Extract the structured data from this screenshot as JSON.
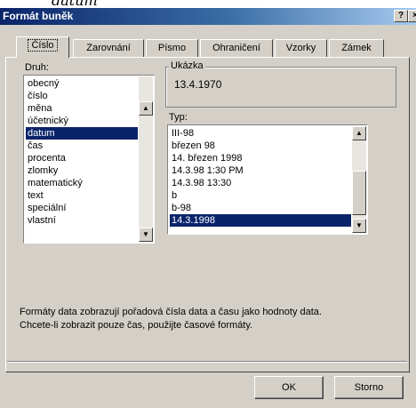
{
  "window": {
    "title": "Formát buněk",
    "help_label": "?",
    "close_label": "×",
    "caption_fragment": "datum"
  },
  "tabs": [
    {
      "label": "Číslo",
      "active": true
    },
    {
      "label": "Zarovnání"
    },
    {
      "label": "Písmo"
    },
    {
      "label": "Ohraničení"
    },
    {
      "label": "Vzorky"
    },
    {
      "label": "Zámek"
    }
  ],
  "category": {
    "label": "Druh:",
    "selected": "datum",
    "items": [
      "obecný",
      "číslo",
      "měna",
      "účetnický",
      "datum",
      "čas",
      "procenta",
      "zlomky",
      "matematický",
      "text",
      "speciální",
      "vlastní"
    ]
  },
  "sample": {
    "label": "Ukázka",
    "value": "13.4.1970"
  },
  "type": {
    "label": "Typ:",
    "selected": "14.3.1998",
    "items": [
      "III-98",
      "březen 98",
      "14. březen 1998",
      "14.3.98 1:30 PM",
      "14.3.98 13:30",
      "b",
      "b-98",
      "14.3.1998"
    ]
  },
  "description": [
    "Formáty data zobrazují pořadová čísla data a času jako hodnoty data.",
    "Chcete-li zobrazit pouze čas, použijte časové formáty."
  ],
  "buttons": {
    "ok": "OK",
    "cancel": "Storno"
  },
  "icons": {
    "scroll_up": "▲",
    "scroll_down": "▼"
  },
  "colors": {
    "selection": "#0a246a",
    "titlebar_start": "#0a246a",
    "titlebar_end": "#a6caf0",
    "face": "#d4d0c8"
  }
}
